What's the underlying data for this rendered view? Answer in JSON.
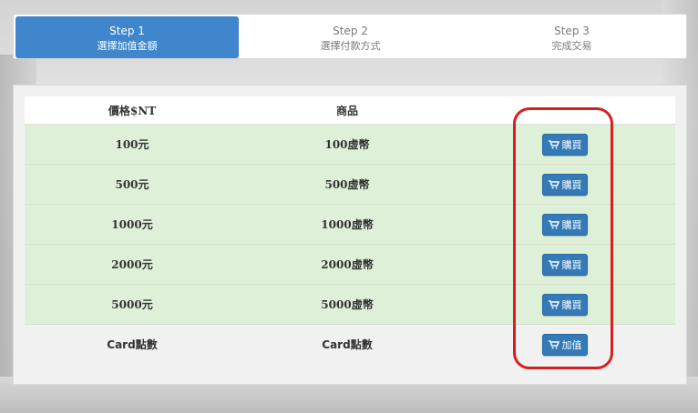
{
  "steps": [
    {
      "number": "Step 1",
      "label": "選擇加值金額",
      "active": true
    },
    {
      "number": "Step 2",
      "label": "選擇付款方式",
      "active": false
    },
    {
      "number": "Step 3",
      "label": "完成交易",
      "active": false
    }
  ],
  "table": {
    "headers": [
      "價格$NT",
      "商品",
      ""
    ],
    "rows": [
      {
        "price": "100元",
        "product": "100虛幣",
        "action": "購買"
      },
      {
        "price": "500元",
        "product": "500虛幣",
        "action": "購買"
      },
      {
        "price": "1000元",
        "product": "1000虛幣",
        "action": "購買"
      },
      {
        "price": "2000元",
        "product": "2000虛幣",
        "action": "購買"
      },
      {
        "price": "5000元",
        "product": "5000虛幣",
        "action": "購買"
      },
      {
        "price": "Card點數",
        "product": "Card點數",
        "action": "加值"
      }
    ]
  },
  "icons": {
    "button_icon": "shopping-cart-icon"
  },
  "colors": {
    "active_step": "#3f86cc",
    "button": "#337ab7",
    "row_highlight": "#dff0d8",
    "annotation": "#d81f1f"
  }
}
